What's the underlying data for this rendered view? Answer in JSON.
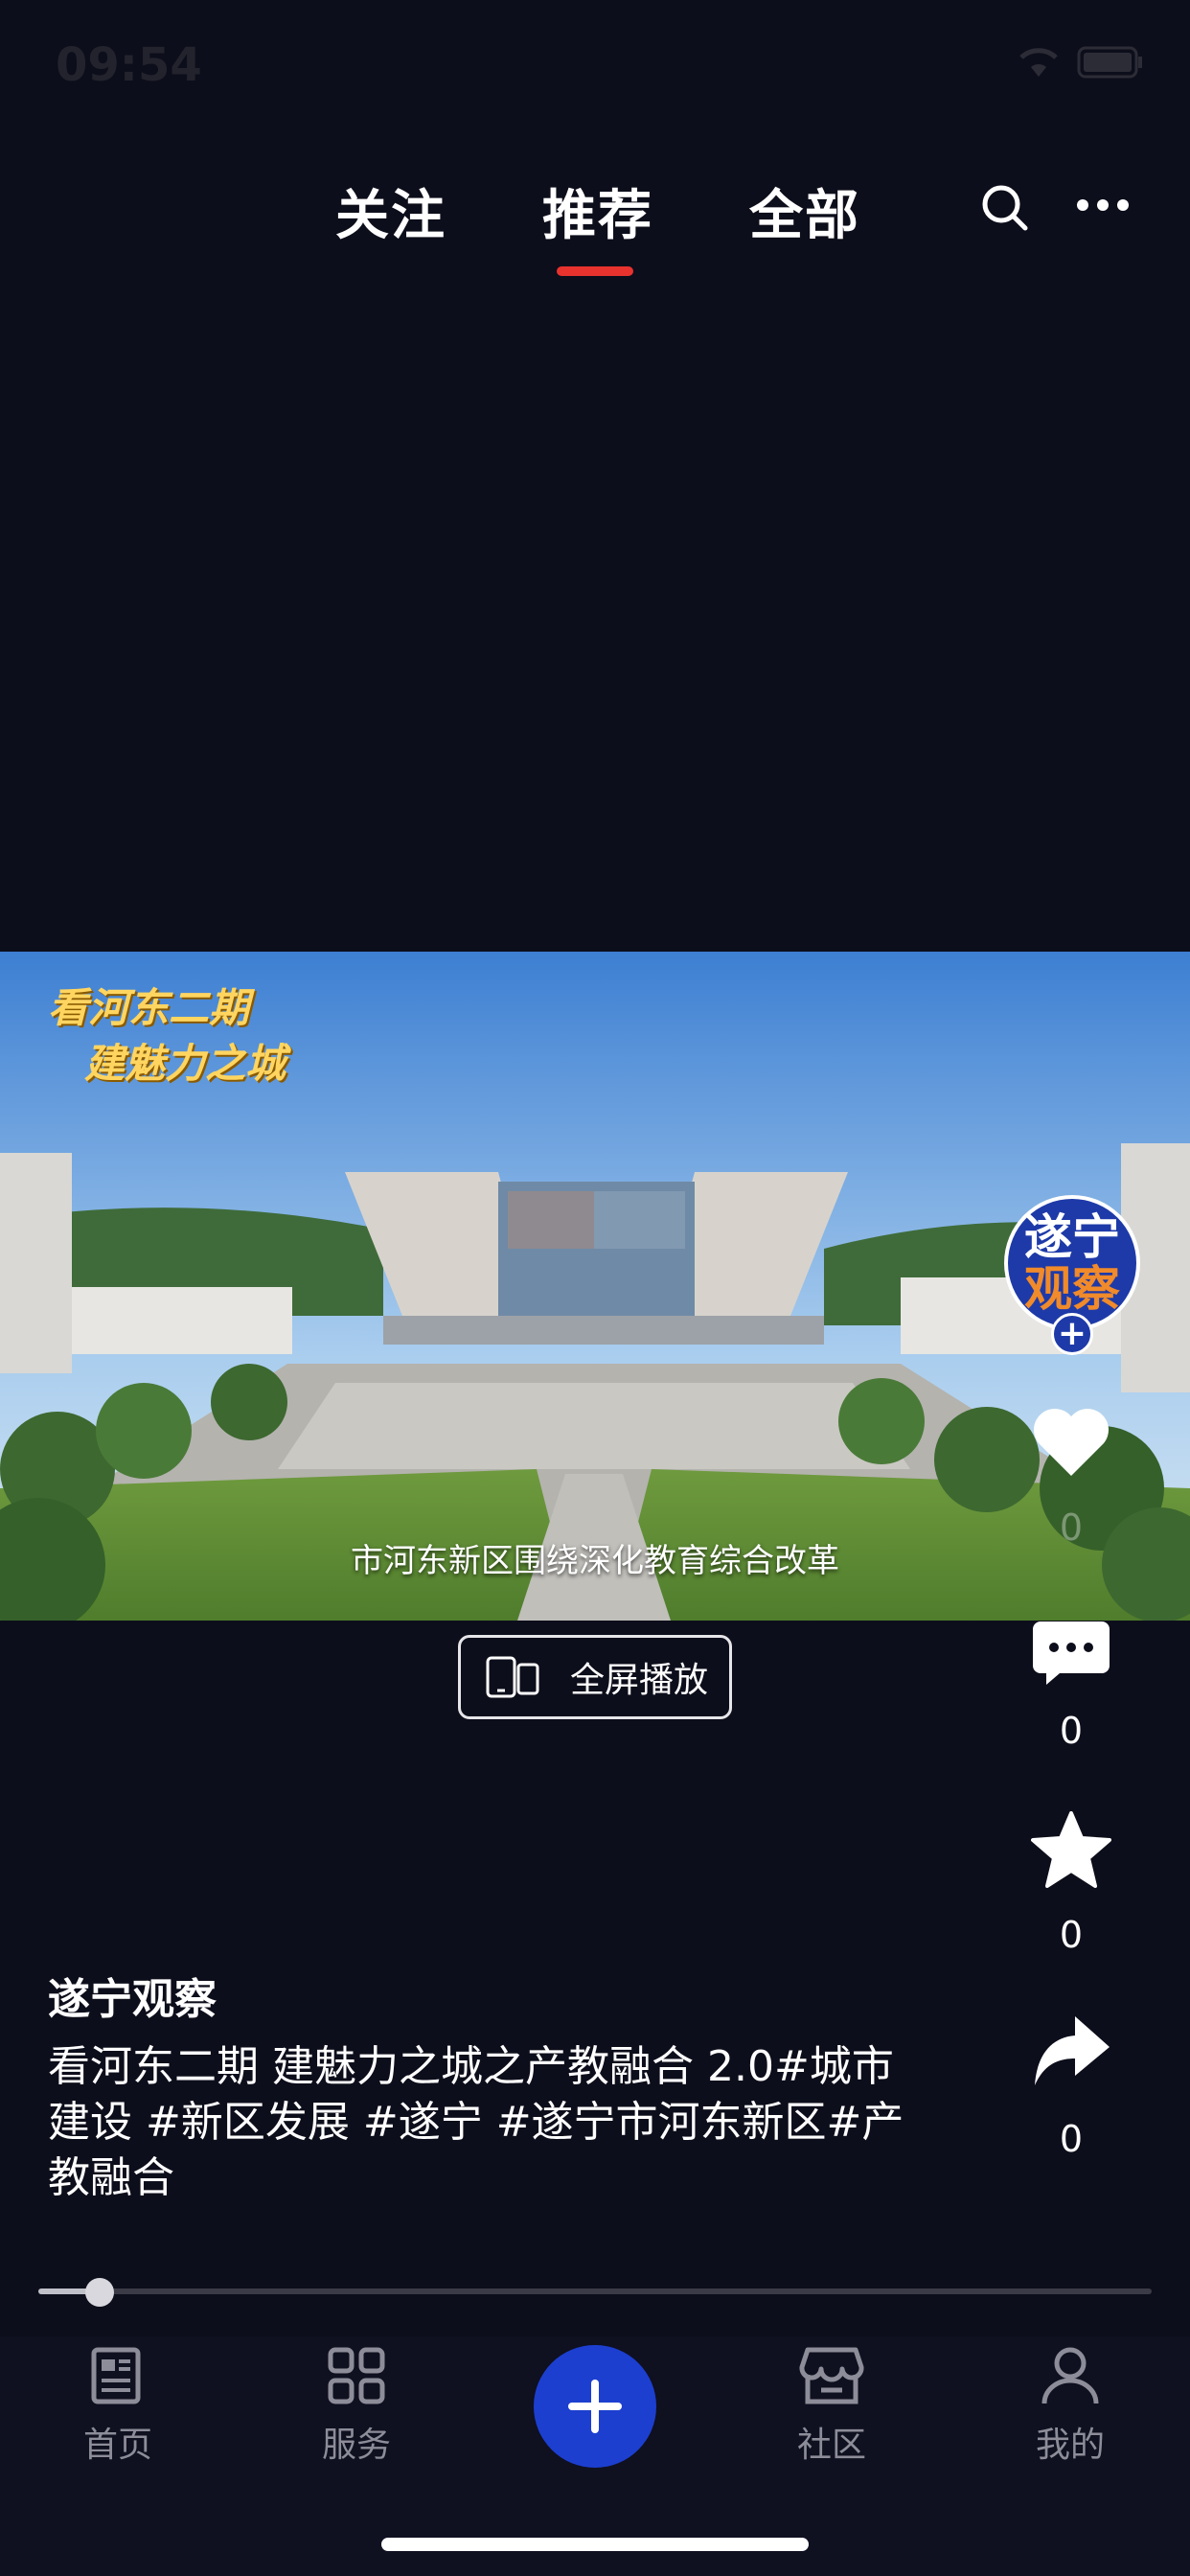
{
  "status_bar": {
    "time": "09:54"
  },
  "top_tabs": [
    {
      "label": "关注"
    },
    {
      "label": "推荐",
      "active": true
    },
    {
      "label": "全部"
    }
  ],
  "video": {
    "overlay_title_line1": "看河东二期",
    "overlay_title_line2": "建魅力之城",
    "subtitle": "市河东新区围绕深化教育综合改革"
  },
  "fullscreen_button": {
    "label": "全屏播放"
  },
  "channel_avatar": {
    "line1": "遂宁",
    "line2": "观察"
  },
  "actions": {
    "like_count": "0",
    "comment_count": "0",
    "favorite_count": "0",
    "share_count": "0"
  },
  "post": {
    "author": "遂宁观察",
    "description": "看河东二期 建魅力之城之产教融合 2.0#城市建设 #新区发展 #遂宁 #遂宁市河东新区#产教融合"
  },
  "playback": {
    "progress": 0.055
  },
  "bottom_nav": [
    {
      "label": "首页",
      "icon": "newspaper-icon"
    },
    {
      "label": "服务",
      "icon": "grid-icon"
    },
    {
      "label": "社区",
      "icon": "store-icon"
    },
    {
      "label": "我的",
      "icon": "user-icon"
    }
  ],
  "colors": {
    "accent_red": "#e8322e",
    "accent_blue": "#1c3fd0",
    "background": "#0d0e1b"
  }
}
